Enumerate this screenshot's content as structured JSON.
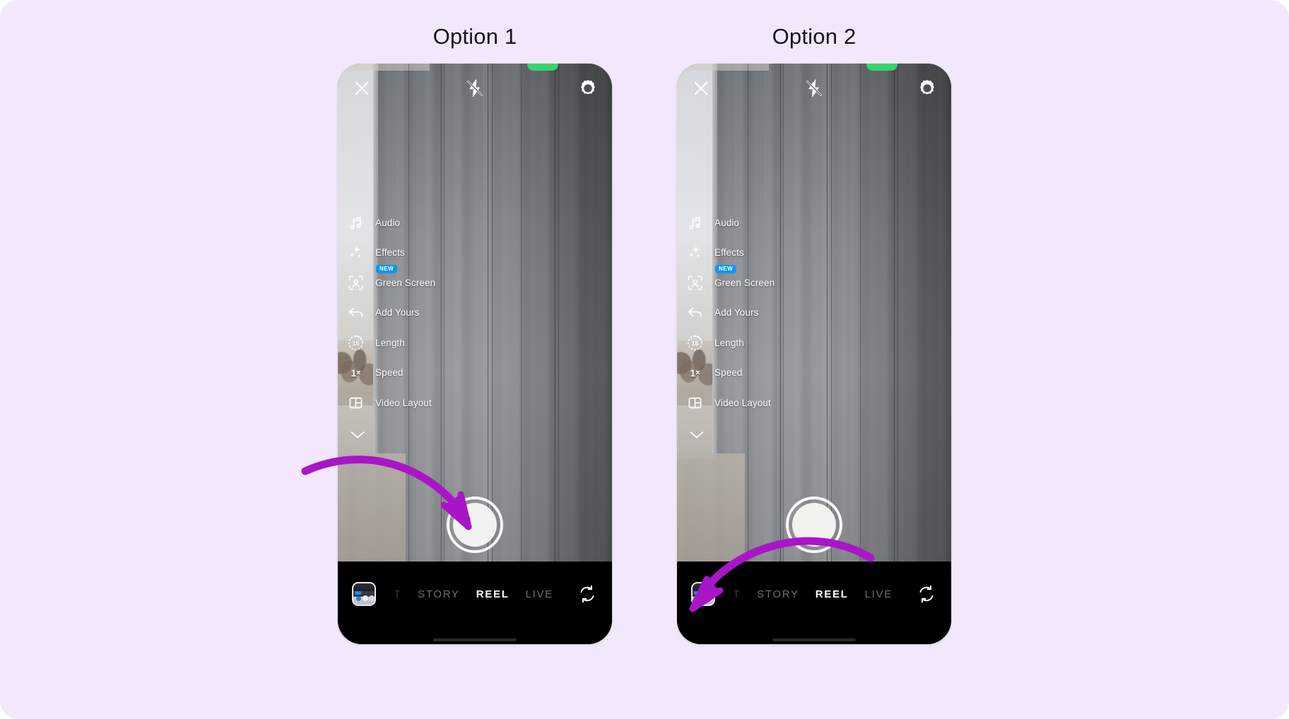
{
  "page": {
    "background_color": "#f3e8fb",
    "accent_arrow_color": "#a916c8"
  },
  "options": [
    {
      "title": "Option 1",
      "phone": {
        "top_bar": {
          "close_icon": "close-x-icon",
          "flash_icon": "flash-off-icon",
          "settings_icon": "gear-icon",
          "notch_indicator_color": "#35d46e"
        },
        "side_menu": [
          {
            "label": "Audio",
            "icon": "music-note-icon",
            "badge": ""
          },
          {
            "label": "Effects",
            "icon": "sparkles-icon",
            "badge": ""
          },
          {
            "label": "Green Screen",
            "icon": "green-screen-icon",
            "badge": "NEW"
          },
          {
            "label": "Add Yours",
            "icon": "reply-arrow-icon",
            "badge": ""
          },
          {
            "label": "Length",
            "icon": "timer-icon",
            "badge": "",
            "icon_text": "15"
          },
          {
            "label": "Speed",
            "icon": "speed-icon",
            "badge": "",
            "icon_text": "1",
            "icon_suffix": "×"
          },
          {
            "label": "Video Layout",
            "icon": "grid-layout-icon",
            "badge": ""
          }
        ],
        "collapse_icon": "chevron-down-icon",
        "shutter": {
          "name": "shutter-button"
        },
        "bottom_bar": {
          "gallery_thumb": "gallery-thumbnail",
          "modes": [
            {
              "label": "POST",
              "active": false,
              "clipped": true
            },
            {
              "label": "STORY",
              "active": false,
              "clipped": false
            },
            {
              "label": "REEL",
              "active": true,
              "clipped": false
            },
            {
              "label": "LIVE",
              "active": false,
              "clipped": false
            }
          ],
          "flip_icon": "camera-flip-icon"
        }
      },
      "arrow": {
        "name": "annotation-arrow-to-shutter",
        "points_to": "shutter-button"
      }
    },
    {
      "title": "Option 2",
      "phone": {
        "top_bar": {
          "close_icon": "close-x-icon",
          "flash_icon": "flash-off-icon",
          "settings_icon": "gear-icon",
          "notch_indicator_color": "#35d46e"
        },
        "side_menu": [
          {
            "label": "Audio",
            "icon": "music-note-icon",
            "badge": ""
          },
          {
            "label": "Effects",
            "icon": "sparkles-icon",
            "badge": ""
          },
          {
            "label": "Green Screen",
            "icon": "green-screen-icon",
            "badge": "NEW"
          },
          {
            "label": "Add Yours",
            "icon": "reply-arrow-icon",
            "badge": ""
          },
          {
            "label": "Length",
            "icon": "timer-icon",
            "badge": "",
            "icon_text": "15"
          },
          {
            "label": "Speed",
            "icon": "speed-icon",
            "badge": "",
            "icon_text": "1",
            "icon_suffix": "×"
          },
          {
            "label": "Video Layout",
            "icon": "grid-layout-icon",
            "badge": ""
          }
        ],
        "collapse_icon": "chevron-down-icon",
        "shutter": {
          "name": "shutter-button"
        },
        "bottom_bar": {
          "gallery_thumb": "gallery-thumbnail",
          "modes": [
            {
              "label": "POST",
              "active": false,
              "clipped": true
            },
            {
              "label": "STORY",
              "active": false,
              "clipped": false
            },
            {
              "label": "REEL",
              "active": true,
              "clipped": false
            },
            {
              "label": "LIVE",
              "active": false,
              "clipped": false
            }
          ],
          "flip_icon": "camera-flip-icon"
        }
      },
      "arrow": {
        "name": "annotation-arrow-to-gallery",
        "points_to": "gallery-thumbnail"
      }
    }
  ]
}
